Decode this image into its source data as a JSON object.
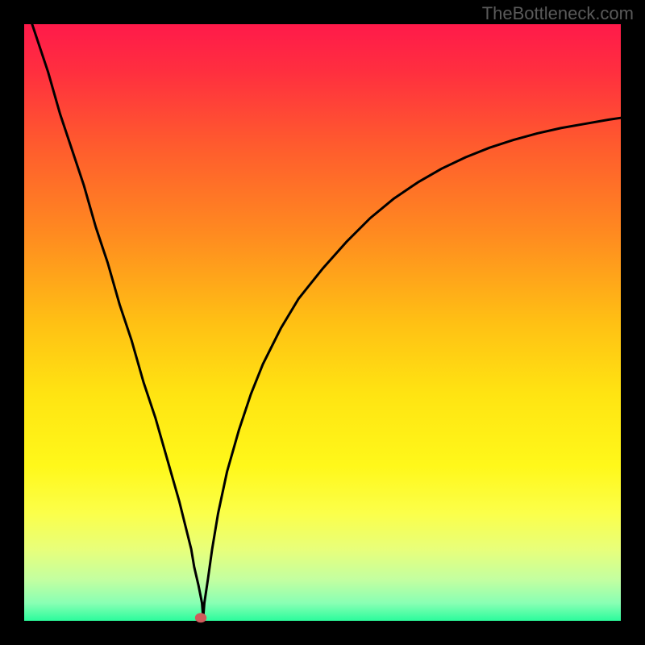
{
  "watermark": "TheBottleneck.com",
  "chart_data": {
    "type": "line",
    "title": "",
    "xlabel": "",
    "ylabel": "",
    "xlim": [
      0,
      100
    ],
    "ylim": [
      0,
      100
    ],
    "background": {
      "type": "vertical-gradient",
      "stops": [
        {
          "offset": 0.0,
          "color": "#ff1a4a"
        },
        {
          "offset": 0.08,
          "color": "#ff2f3f"
        },
        {
          "offset": 0.2,
          "color": "#ff5a2e"
        },
        {
          "offset": 0.35,
          "color": "#ff8a20"
        },
        {
          "offset": 0.5,
          "color": "#ffc014"
        },
        {
          "offset": 0.62,
          "color": "#ffe412"
        },
        {
          "offset": 0.74,
          "color": "#fff81a"
        },
        {
          "offset": 0.82,
          "color": "#fbff4a"
        },
        {
          "offset": 0.88,
          "color": "#e8ff7a"
        },
        {
          "offset": 0.93,
          "color": "#c4ffa0"
        },
        {
          "offset": 0.97,
          "color": "#8affb4"
        },
        {
          "offset": 1.0,
          "color": "#2bfc9c"
        }
      ]
    },
    "series": [
      {
        "name": "bottleneck-curve",
        "x": [
          0,
          2,
          4,
          6,
          8,
          10,
          12,
          14,
          16,
          18,
          20,
          22,
          24,
          26,
          27,
          28,
          28.5,
          29.2,
          29.8,
          30.0,
          30.2,
          30.8,
          31.5,
          32.5,
          34,
          36,
          38,
          40,
          43,
          46,
          50,
          54,
          58,
          62,
          66,
          70,
          74,
          78,
          82,
          86,
          90,
          94,
          98,
          100
        ],
        "values": [
          104,
          98,
          92,
          85,
          79,
          73,
          66,
          60,
          53,
          47,
          40,
          34,
          27,
          20,
          16,
          12,
          9.0,
          6.0,
          3.0,
          0.5,
          3.0,
          7.0,
          12.0,
          18.0,
          25,
          32,
          38,
          43,
          49,
          54,
          59,
          63.5,
          67.5,
          70.8,
          73.5,
          75.8,
          77.7,
          79.3,
          80.6,
          81.7,
          82.6,
          83.3,
          84.0,
          84.3
        ]
      }
    ],
    "marker": {
      "x": 29.6,
      "y": 0.5,
      "color": "#cf5b5b",
      "radius": 6
    },
    "frame": {
      "color": "#000000",
      "thickness_ratio": 0.037
    }
  }
}
